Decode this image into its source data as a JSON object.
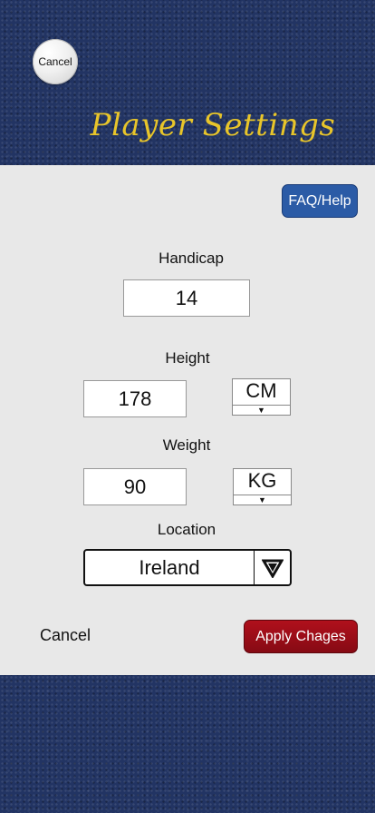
{
  "header": {
    "cancel_label": "Cancel",
    "title": "Player Settings"
  },
  "faq_label": "FAQ/Help",
  "handicap": {
    "label": "Handicap",
    "value": "14"
  },
  "height": {
    "label": "Height",
    "value": "178",
    "unit": "CM"
  },
  "weight": {
    "label": "Weight",
    "value": "90",
    "unit": "KG"
  },
  "location": {
    "label": "Location",
    "value": "Ireland"
  },
  "footer": {
    "cancel_label": "Cancel",
    "apply_label": "Apply Chages"
  },
  "colors": {
    "title": "#e8c52a",
    "faq_button": "#2b5ba6",
    "apply_button": "#a00e19",
    "panel": "#e8e8e8",
    "denim": "#223463"
  }
}
